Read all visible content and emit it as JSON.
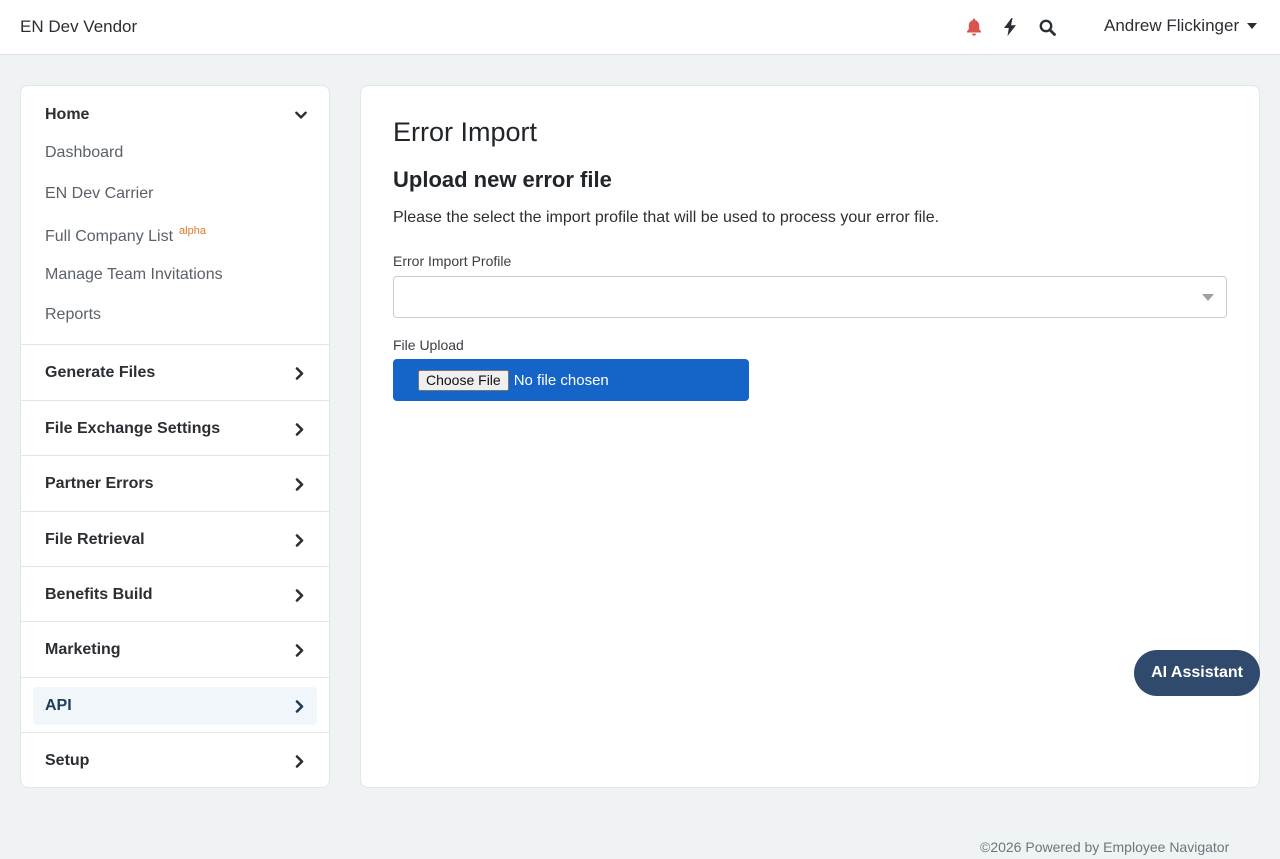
{
  "header": {
    "brand": "EN Dev Vendor",
    "icons": [
      "bell-icon",
      "bolt-icon",
      "search-icon"
    ],
    "user_name": "Andrew Flickinger",
    "colors": {
      "bell": "#d9534f",
      "text": "#2b2f33"
    }
  },
  "sidebar": {
    "home": {
      "label": "Home",
      "items": [
        {
          "label": "Dashboard"
        },
        {
          "label": "EN Dev Carrier"
        },
        {
          "label": "Full Company List",
          "badge": "alpha"
        },
        {
          "label": "Manage Team Invitations"
        },
        {
          "label": "Reports"
        }
      ]
    },
    "sections": [
      {
        "label": "Generate Files"
      },
      {
        "label": "File Exchange Settings"
      },
      {
        "label": "Partner Errors"
      },
      {
        "label": "File Retrieval"
      },
      {
        "label": "Benefits Build"
      },
      {
        "label": "Marketing"
      },
      {
        "label": "API",
        "active": true
      },
      {
        "label": "Setup"
      }
    ]
  },
  "main": {
    "title": "Error Import",
    "subtitle": "Upload new error file",
    "description": "Please the select the import profile that will be used to process your error file.",
    "profile_label": "Error Import Profile",
    "profile_value": "",
    "upload_label": "File Upload",
    "choose_file_label": "Choose File",
    "file_status": "No file chosen",
    "accent_color": "#1565c8"
  },
  "assistant": {
    "label": "AI Assistant",
    "color": "#2f4a6d"
  },
  "footer": {
    "text": "©2026 Powered by Employee Navigator"
  }
}
